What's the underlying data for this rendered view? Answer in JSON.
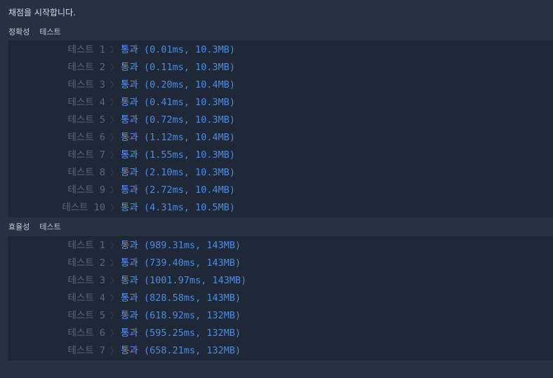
{
  "status_message": "채점을 시작합니다.",
  "sections": [
    {
      "name": "accuracy",
      "category": "정확성",
      "label": "테스트",
      "rows": [
        {
          "label": "테스트 1",
          "verdict": "통과",
          "detail": "(0.01ms, 10.3MB)"
        },
        {
          "label": "테스트 2",
          "verdict": "통과",
          "detail": "(0.11ms, 10.3MB)"
        },
        {
          "label": "테스트 3",
          "verdict": "통과",
          "detail": "(0.20ms, 10.4MB)"
        },
        {
          "label": "테스트 4",
          "verdict": "통과",
          "detail": "(0.41ms, 10.3MB)"
        },
        {
          "label": "테스트 5",
          "verdict": "통과",
          "detail": "(0.72ms, 10.3MB)"
        },
        {
          "label": "테스트 6",
          "verdict": "통과",
          "detail": "(1.12ms, 10.4MB)"
        },
        {
          "label": "테스트 7",
          "verdict": "통과",
          "detail": "(1.55ms, 10.3MB)"
        },
        {
          "label": "테스트 8",
          "verdict": "통과",
          "detail": "(2.10ms, 10.3MB)"
        },
        {
          "label": "테스트 9",
          "verdict": "통과",
          "detail": "(2.72ms, 10.4MB)"
        },
        {
          "label": "테스트 10",
          "verdict": "통과",
          "detail": "(4.31ms, 10.5MB)"
        }
      ]
    },
    {
      "name": "efficiency",
      "category": "효율성",
      "label": "테스트",
      "rows": [
        {
          "label": "테스트 1",
          "verdict": "통과",
          "detail": "(989.31ms, 143MB)"
        },
        {
          "label": "테스트 2",
          "verdict": "통과",
          "detail": "(739.40ms, 143MB)"
        },
        {
          "label": "테스트 3",
          "verdict": "통과",
          "detail": "(1001.97ms, 143MB)"
        },
        {
          "label": "테스트 4",
          "verdict": "통과",
          "detail": "(828.58ms, 143MB)"
        },
        {
          "label": "테스트 5",
          "verdict": "통과",
          "detail": "(618.92ms, 132MB)"
        },
        {
          "label": "테스트 6",
          "verdict": "통과",
          "detail": "(595.25ms, 132MB)"
        },
        {
          "label": "테스트 7",
          "verdict": "통과",
          "detail": "(658.21ms, 132MB)"
        }
      ]
    }
  ],
  "separator_glyph": "〉",
  "colors": {
    "background": "#263142",
    "panel": "#1e2837",
    "pass_text": "#4a8ce7",
    "test_label": "#5e6977"
  },
  "icons": {
    "separator": "chevron-right-icon"
  }
}
